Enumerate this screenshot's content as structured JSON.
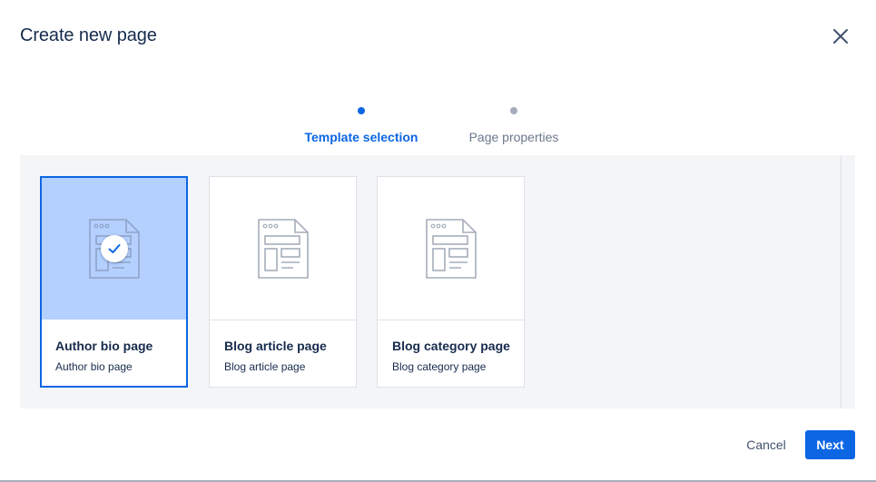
{
  "dialog": {
    "title": "Create new page",
    "close_icon": "close-icon"
  },
  "steps": [
    {
      "label": "Template selection",
      "state": "active"
    },
    {
      "label": "Page properties",
      "state": "inactive"
    }
  ],
  "templates": [
    {
      "name": "Author bio page",
      "description": "Author bio page",
      "selected": true,
      "icon": "page-template-icon"
    },
    {
      "name": "Blog article page",
      "description": "Blog article page",
      "selected": false,
      "icon": "page-template-icon"
    },
    {
      "name": "Blog category page",
      "description": "Blog category page",
      "selected": false,
      "icon": "page-template-icon"
    }
  ],
  "footer": {
    "cancel_label": "Cancel",
    "next_label": "Next"
  },
  "colors": {
    "accent": "#0c66e4",
    "selected_bg": "#b3d0ff",
    "gallery_bg": "#f4f5f7",
    "text": "#172b4d"
  }
}
